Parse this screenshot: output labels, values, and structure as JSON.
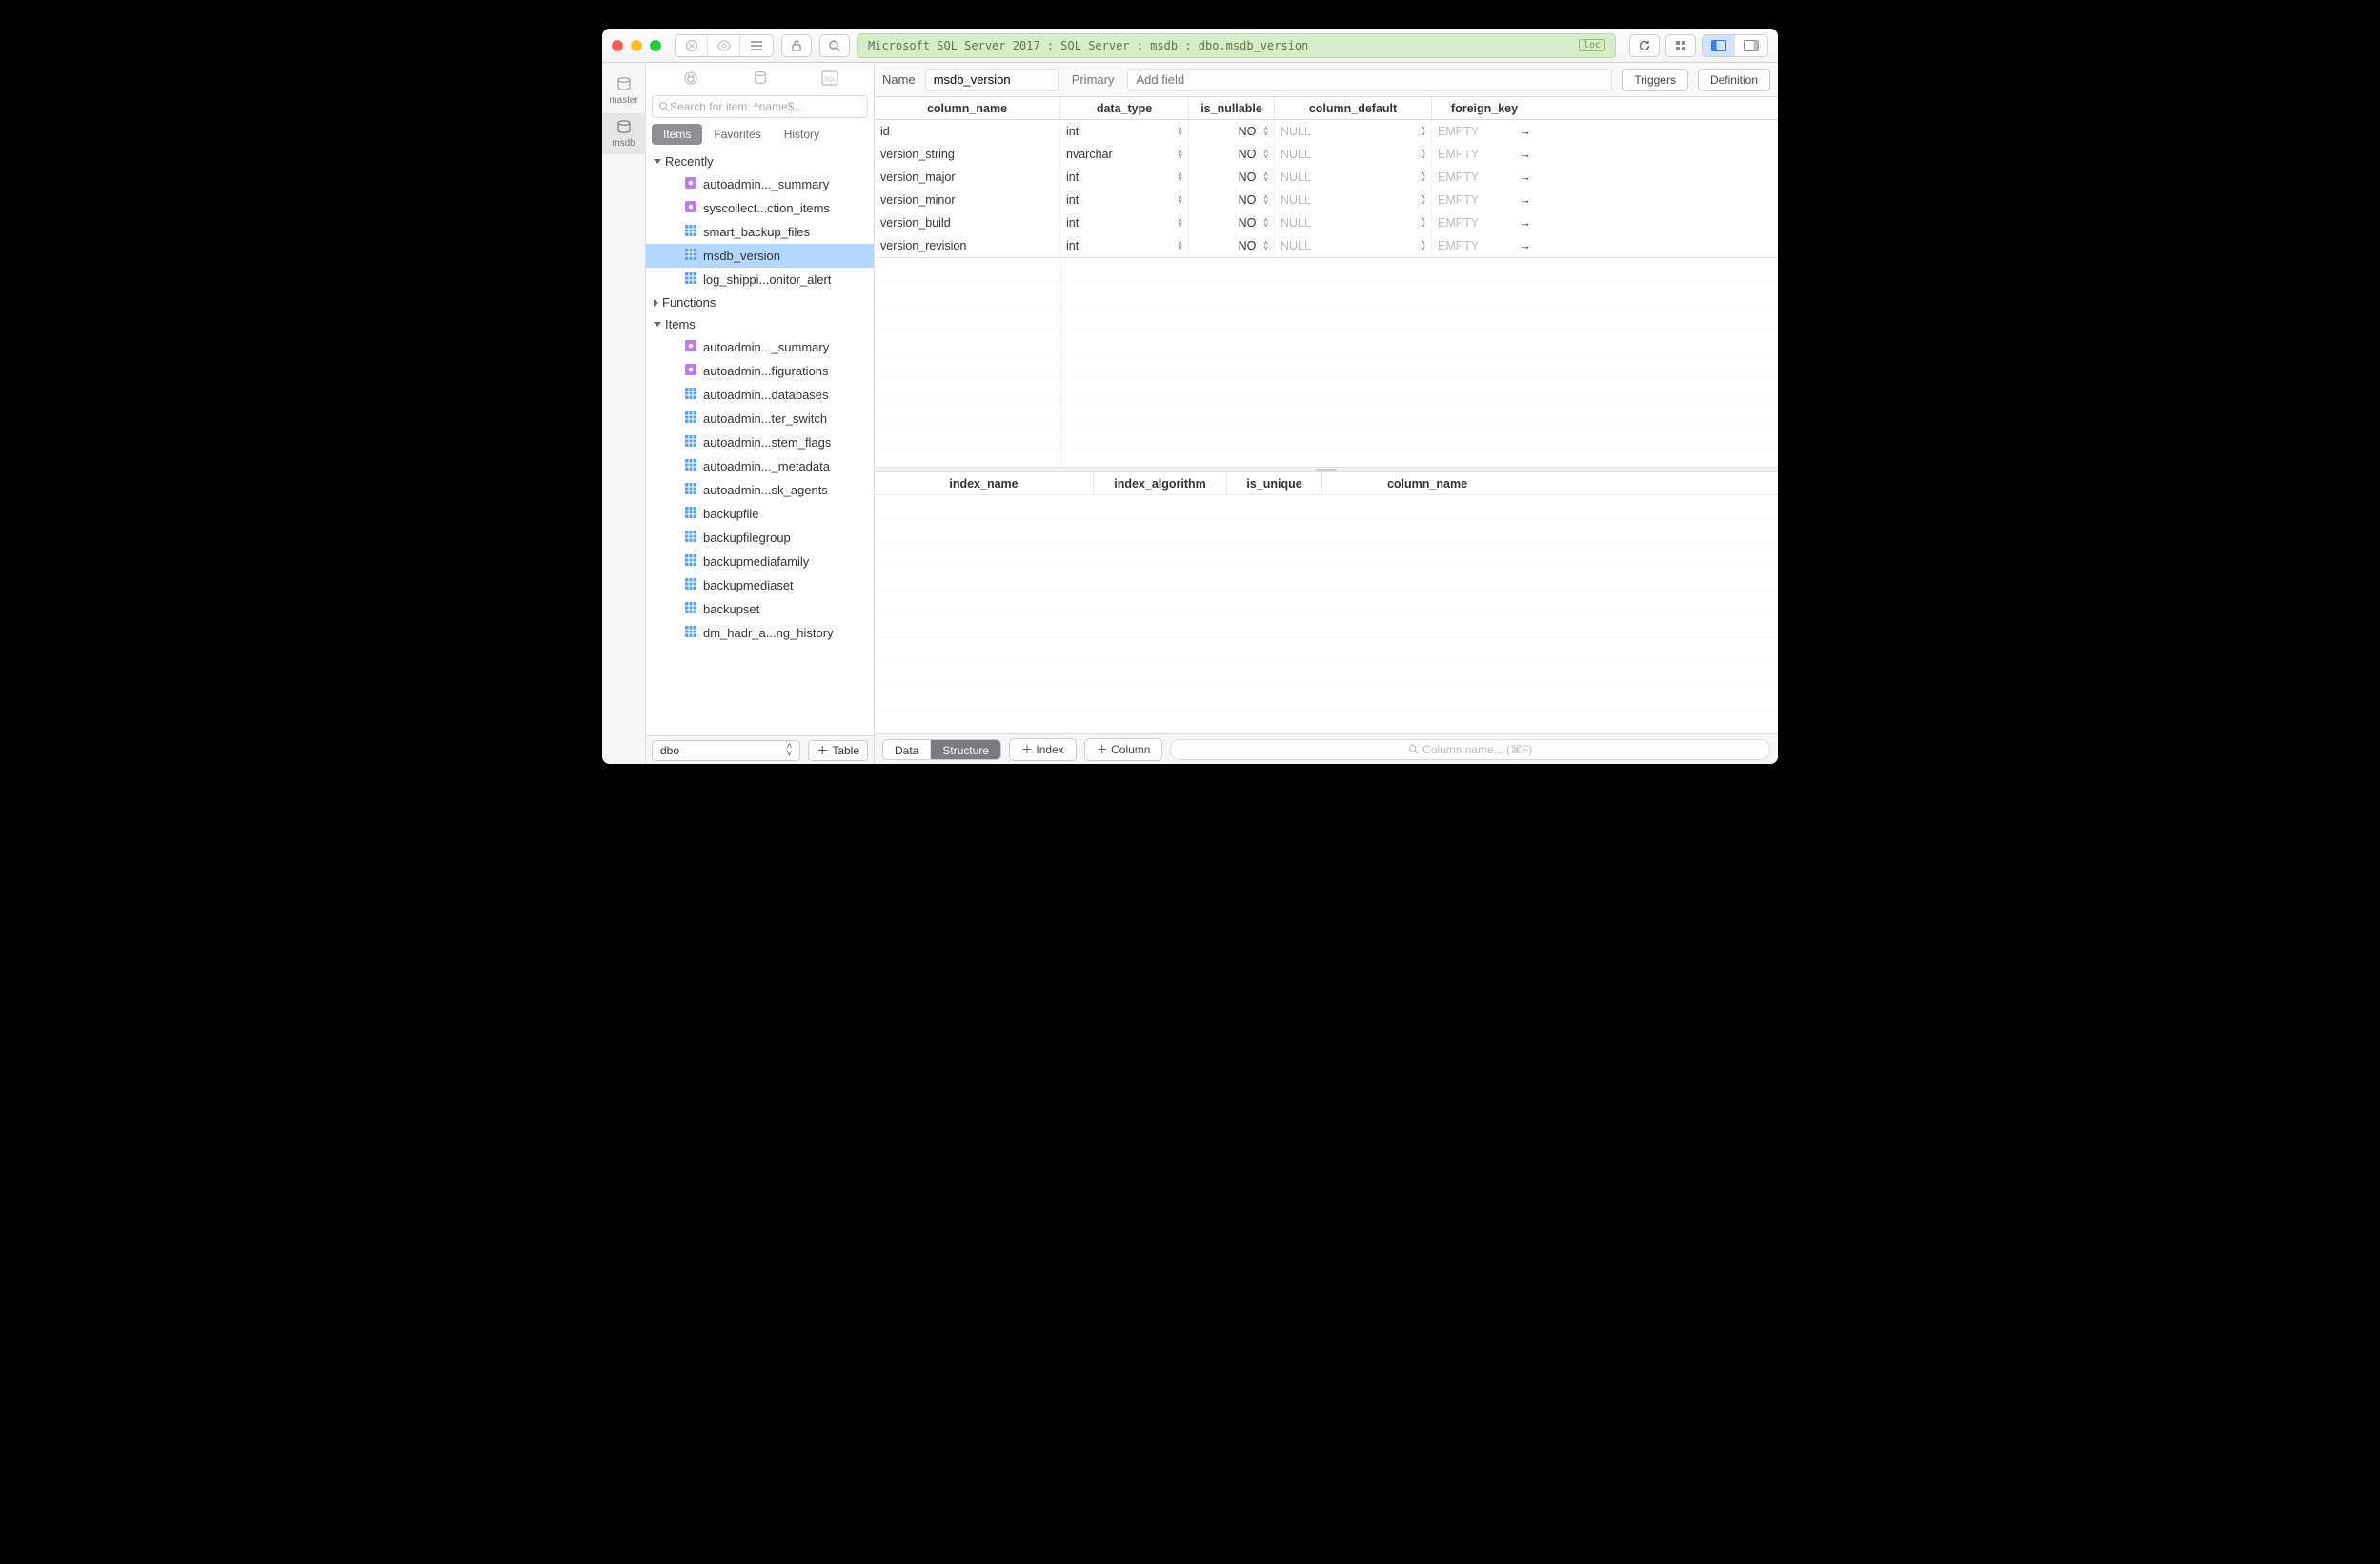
{
  "titlebar": {
    "breadcrumb": "Microsoft SQL Server 2017 : SQL Server : msdb : dbo.msdb_version",
    "loc_badge": "loc"
  },
  "db_rail": [
    {
      "name": "master",
      "selected": false
    },
    {
      "name": "msdb",
      "selected": true
    }
  ],
  "sidebar": {
    "search_placeholder": "Search for item: ^name$...",
    "tabs": {
      "items": "Items",
      "favorites": "Favorites",
      "history": "History"
    },
    "recently_label": "Recently",
    "recently": [
      {
        "icon": "view",
        "label": "autoadmin..._summary",
        "selected": false
      },
      {
        "icon": "view",
        "label": "syscollect...ction_items",
        "selected": false
      },
      {
        "icon": "table",
        "label": "smart_backup_files",
        "selected": false
      },
      {
        "icon": "table",
        "label": "msdb_version",
        "selected": true
      },
      {
        "icon": "table",
        "label": "log_shippi...onitor_alert",
        "selected": false
      }
    ],
    "functions_label": "Functions",
    "items_label": "Items",
    "items": [
      {
        "icon": "view",
        "label": "autoadmin..._summary"
      },
      {
        "icon": "view",
        "label": "autoadmin...figurations"
      },
      {
        "icon": "table",
        "label": "autoadmin...databases"
      },
      {
        "icon": "table",
        "label": "autoadmin...ter_switch"
      },
      {
        "icon": "table",
        "label": "autoadmin...stem_flags"
      },
      {
        "icon": "table",
        "label": "autoadmin..._metadata"
      },
      {
        "icon": "table",
        "label": "autoadmin...sk_agents"
      },
      {
        "icon": "table",
        "label": "backupfile"
      },
      {
        "icon": "table",
        "label": "backupfilegroup"
      },
      {
        "icon": "table",
        "label": "backupmediafamily"
      },
      {
        "icon": "table",
        "label": "backupmediaset"
      },
      {
        "icon": "table",
        "label": "backupset"
      },
      {
        "icon": "table",
        "label": "dm_hadr_a...ng_history"
      }
    ],
    "schema": "dbo",
    "add_table": "Table"
  },
  "namebar": {
    "label": "Name",
    "value": "msdb_version",
    "primary": "Primary",
    "add_field_placeholder": "Add field",
    "triggers": "Triggers",
    "definition": "Definition"
  },
  "columns": {
    "headers": {
      "column_name": "column_name",
      "data_type": "data_type",
      "is_nullable": "is_nullable",
      "column_default": "column_default",
      "foreign_key": "foreign_key"
    },
    "rows": [
      {
        "name": "id",
        "type": "int",
        "nullable": "NO",
        "default": "NULL",
        "fk": "EMPTY"
      },
      {
        "name": "version_string",
        "type": "nvarchar",
        "nullable": "NO",
        "default": "NULL",
        "fk": "EMPTY"
      },
      {
        "name": "version_major",
        "type": "int",
        "nullable": "NO",
        "default": "NULL",
        "fk": "EMPTY"
      },
      {
        "name": "version_minor",
        "type": "int",
        "nullable": "NO",
        "default": "NULL",
        "fk": "EMPTY"
      },
      {
        "name": "version_build",
        "type": "int",
        "nullable": "NO",
        "default": "NULL",
        "fk": "EMPTY"
      },
      {
        "name": "version_revision",
        "type": "int",
        "nullable": "NO",
        "default": "NULL",
        "fk": "EMPTY"
      }
    ]
  },
  "indexes": {
    "headers": {
      "index_name": "index_name",
      "index_algorithm": "index_algorithm",
      "is_unique": "is_unique",
      "column_name": "column_name"
    }
  },
  "bottombar": {
    "data": "Data",
    "structure": "Structure",
    "index": "Index",
    "column": "Column",
    "filter_placeholder": "Column name... (⌘F)"
  }
}
